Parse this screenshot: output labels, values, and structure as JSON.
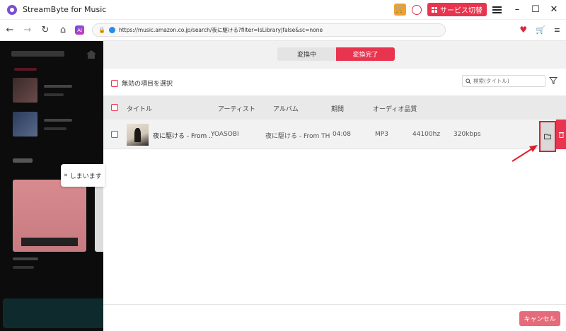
{
  "app": {
    "title": "StreamByte for Music",
    "service_switch_label": "サービス切替",
    "cart_icon": "cart-icon",
    "brand_color": "#e8344e"
  },
  "nav": {
    "url": "https://music.amazon.co.jp/search/夜に駆ける?filter=IsLibrary|false&sc=none",
    "ai_label": "AI"
  },
  "web": {
    "hide_label": "しまいます"
  },
  "converter": {
    "tabs": [
      {
        "label": "変換中",
        "active": false
      },
      {
        "label": "変換完了",
        "active": true
      }
    ],
    "select_invalid_label": "無効の項目を選択",
    "search_placeholder": "検索(タイトル)",
    "columns": {
      "title": "タイトル",
      "artist": "アーティスト",
      "album": "アルバム",
      "duration": "期間",
      "audio_quality": "オーディオ品質"
    },
    "rows": [
      {
        "title": "夜に駆ける - From ...",
        "artist": "YOASOBI",
        "album": "夜に駆ける - From TH...",
        "duration": "04:08",
        "format": "MP3",
        "sample_rate": "44100hz",
        "bitrate": "320kbps"
      }
    ],
    "cancel_label": "キャンセル"
  }
}
